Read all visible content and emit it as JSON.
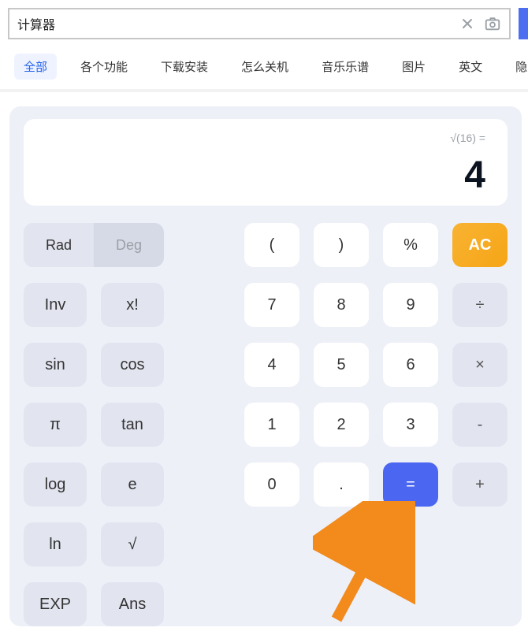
{
  "search": {
    "value": "计算器",
    "clear_icon": "close",
    "camera_icon": "camera"
  },
  "tabs": {
    "items": [
      {
        "label": "全部",
        "active": true
      },
      {
        "label": "各个功能"
      },
      {
        "label": "下载安装"
      },
      {
        "label": "怎么关机"
      },
      {
        "label": "音乐乐谱"
      },
      {
        "label": "图片"
      },
      {
        "label": "英文"
      },
      {
        "label": "隐"
      }
    ]
  },
  "display": {
    "expression": "√(16) =",
    "result": "4"
  },
  "mode": {
    "rad": "Rad",
    "deg": "Deg",
    "active": "rad"
  },
  "keys": {
    "lparen": "(",
    "rparen": ")",
    "percent": "%",
    "ac": "AC",
    "inv": "Inv",
    "fact": "x!",
    "d7": "7",
    "d8": "8",
    "d9": "9",
    "div": "÷",
    "sin": "sin",
    "cos": "cos",
    "d4": "4",
    "d5": "5",
    "d6": "6",
    "mul": "×",
    "pi": "π",
    "tan": "tan",
    "d1": "1",
    "d2": "2",
    "d3": "3",
    "sub": "-",
    "log": "log",
    "e": "e",
    "d0": "0",
    "dot": ".",
    "eq": "=",
    "add": "+",
    "ln": "ln",
    "sqrt": "√",
    "exp": "EXP",
    "ans": "Ans"
  }
}
